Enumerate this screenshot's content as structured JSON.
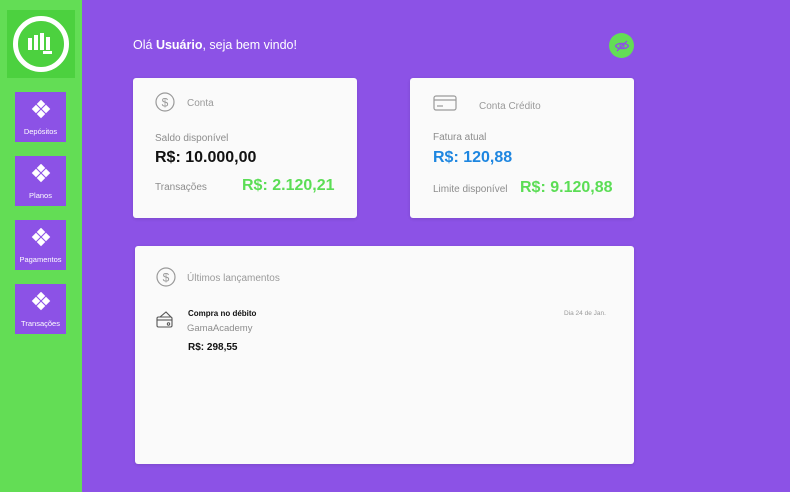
{
  "greeting": {
    "prefix": "Olá ",
    "user": "Usuário",
    "suffix": ", seja bem vindo!"
  },
  "sidebar": {
    "items": [
      {
        "label": "Depósitos"
      },
      {
        "label": "Planos"
      },
      {
        "label": "Pagamentos"
      },
      {
        "label": "Transações"
      }
    ]
  },
  "account_card": {
    "title": "Conta",
    "balance_label": "Saldo disponível",
    "balance": "R$: 10.000,00",
    "transactions_label": "Transações",
    "transactions": "R$: 2.120,21"
  },
  "credit_card": {
    "title": "Conta Crédito",
    "invoice_label": "Fatura atual",
    "invoice": "R$: 120,88",
    "limit_label": "Limite disponível",
    "limit": "R$: 9.120,88"
  },
  "latest": {
    "title": "Últimos lançamentos",
    "entries": [
      {
        "title": "Compra no débito",
        "merchant": "GamaAcademy",
        "value": "R$: 298,55",
        "date": "Dia  24 de Jan."
      }
    ]
  },
  "colors": {
    "green": "#63dd55",
    "purple": "#8c52e6",
    "blue": "#1e86e0"
  }
}
